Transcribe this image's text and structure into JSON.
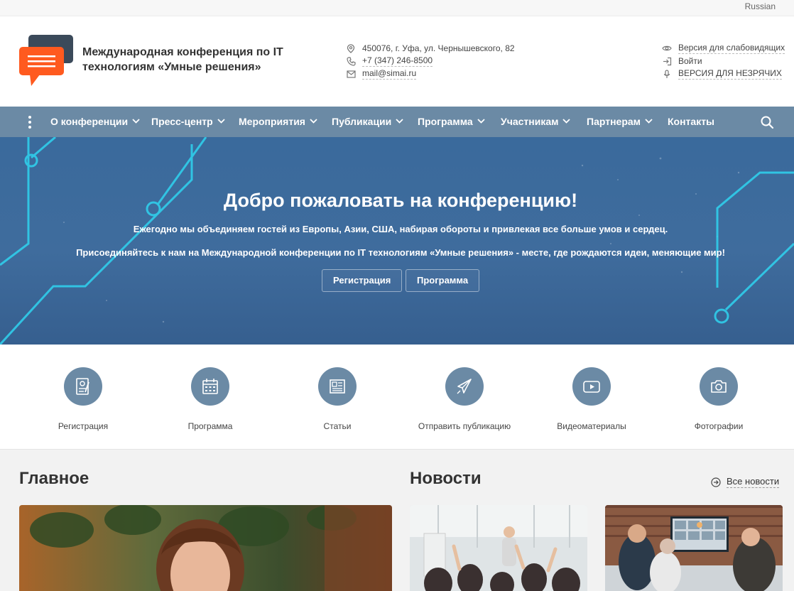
{
  "topbar": {
    "language": "Russian"
  },
  "header": {
    "brand_title": "Международная конференция по IT технологиям «Умные решения»",
    "address": "450076, г. Уфа, ул. Чернышевского, 82",
    "phone": "+7 (347) 246-8500",
    "email": "mail@simai.ru",
    "low_vision": "Версия для слабовидящих",
    "login": "Войти",
    "blind_version": "ВЕРСИЯ ДЛЯ НЕЗРЯЧИХ"
  },
  "nav": {
    "items": [
      {
        "label": "О конференции",
        "has_dropdown": true
      },
      {
        "label": "Пресс-центр",
        "has_dropdown": true
      },
      {
        "label": "Мероприятия",
        "has_dropdown": true
      },
      {
        "label": "Публикации",
        "has_dropdown": true
      },
      {
        "label": "Программа",
        "has_dropdown": true
      },
      {
        "label": "Участникам",
        "has_dropdown": true
      },
      {
        "label": "Партнерам",
        "has_dropdown": true
      },
      {
        "label": "Контакты",
        "has_dropdown": false
      }
    ]
  },
  "hero": {
    "title": "Добро пожаловать на конференцию!",
    "subtitle1": "Ежегодно мы объединяем гостей из Европы, Азии, США, набирая обороты и привлекая все больше умов и сердец.",
    "subtitle2": "Присоединяйтесь к нам на Международной конференции по IT технологиям «Умные решения» - месте, где рождаются идеи, меняющие мир!",
    "buttons": [
      "Регистрация",
      "Программа"
    ]
  },
  "quick_links": [
    {
      "label": "Регистрация",
      "icon": "registration-form-icon"
    },
    {
      "label": "Программа",
      "icon": "calendar-icon"
    },
    {
      "label": "Статьи",
      "icon": "newspaper-icon"
    },
    {
      "label": "Отправить публикацию",
      "icon": "paper-plane-icon"
    },
    {
      "label": "Видеоматериалы",
      "icon": "video-play-icon"
    },
    {
      "label": "Фотографии",
      "icon": "camera-icon"
    }
  ],
  "sections": {
    "main_title": "Главное",
    "news_title": "Новости",
    "all_news": "Все новости"
  },
  "colors": {
    "nav_bg": "#6b8aa5",
    "hero_bg": "#3f6c9d",
    "logo_orange": "#ff5a1f",
    "logo_dark": "#3b4a5a",
    "circuit": "#2fd4f0"
  }
}
